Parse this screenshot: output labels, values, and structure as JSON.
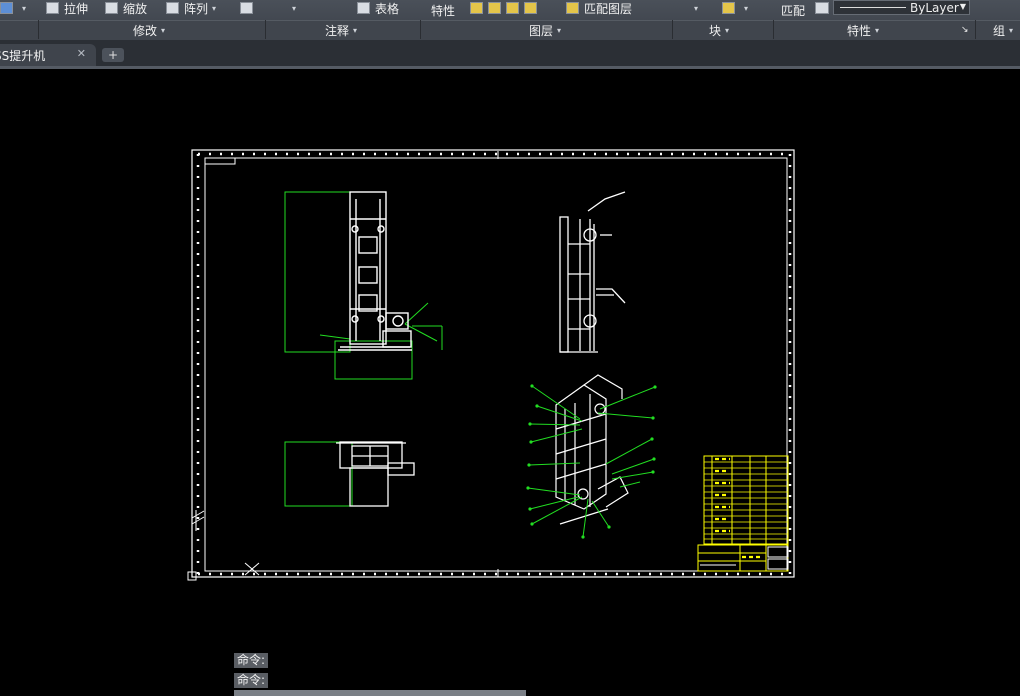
{
  "ribbon": {
    "tools": {
      "stretch": "拉伸",
      "scale": "缩放",
      "array": "阵列",
      "table": "表格",
      "properties": "特性",
      "match_layer": "匹配图层",
      "match": "匹配"
    },
    "linetype_value": "ByLayer",
    "panels": {
      "modify": "修改",
      "annotation": "注释",
      "layers": "图层",
      "block": "块",
      "properties": "特性",
      "group": "组"
    }
  },
  "tabs": {
    "document": "SS提升机",
    "new_tab": "+",
    "close": "✕"
  },
  "command_line": {
    "history": [
      "命令:",
      "命令:"
    ]
  },
  "colors": {
    "drawing_background": "#000000",
    "geometry_white": "#ffffff",
    "dimension_green": "#22dd22",
    "titleblock_yellow": "#ffff00"
  }
}
